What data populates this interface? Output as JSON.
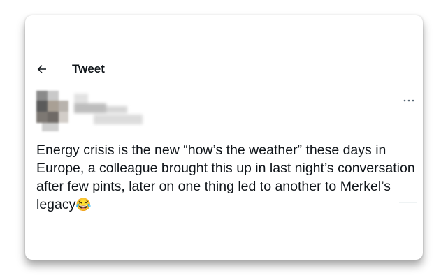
{
  "header": {
    "back_icon": "arrow-left-icon",
    "title": "Tweet"
  },
  "author": {
    "avatar_blurred": true,
    "name_blurred": true
  },
  "more_icon": "more-horizontal-icon",
  "tweet": {
    "text": "Energy crisis is the new “how’s the weather” these days in Europe, a colleague brought this up in last night’s conversation after few pints, later on one thing led to another to Merkel’s legacy",
    "emoji": "😂"
  },
  "colors": {
    "text": "#0f1419",
    "background": "#ffffff"
  }
}
